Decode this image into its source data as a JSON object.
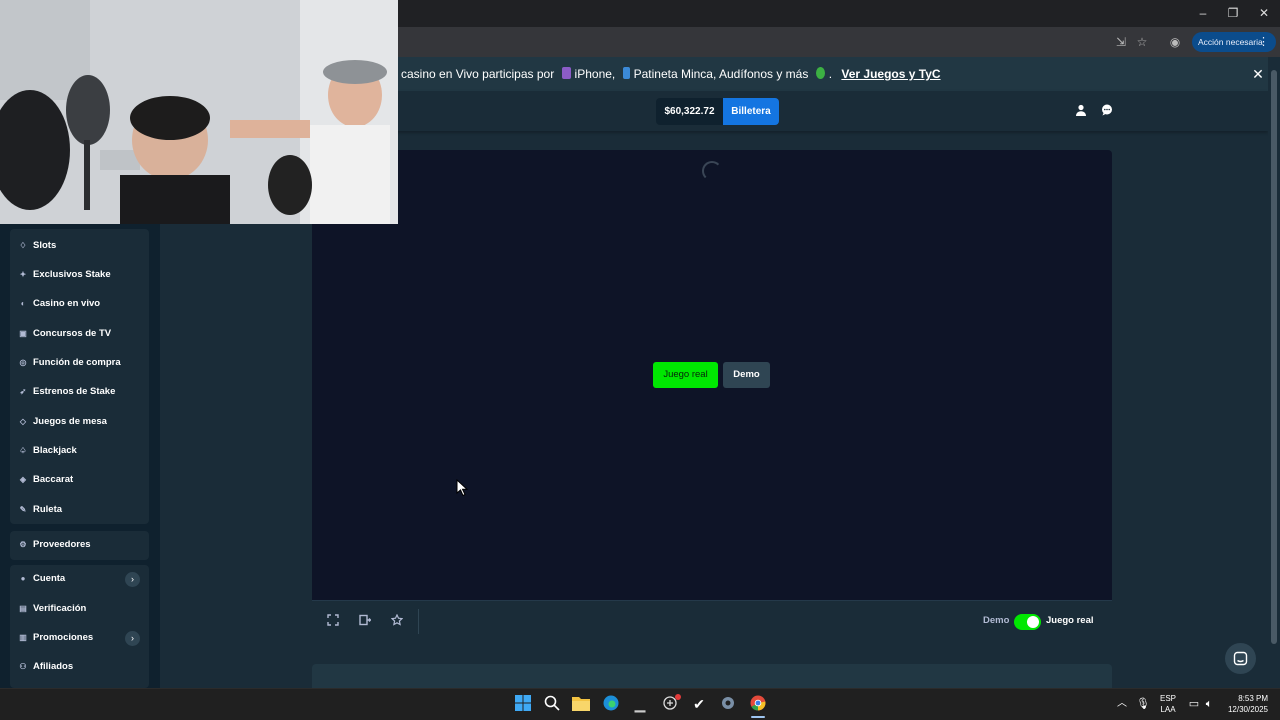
{
  "browser": {
    "window_controls": {
      "minimize": "–",
      "restore": "❐",
      "close": "✕"
    },
    "action_button_label": "Acción necesaria"
  },
  "banner": {
    "text_prefix": "casino en Vivo participas por",
    "item_1": "iPhone,",
    "item_2": "Patineta Minca, Audífonos y más",
    "suffix": ".",
    "link": "Ver Juegos y TyC",
    "close": "✕"
  },
  "header": {
    "balance": "$60,322.72",
    "wallet_label": "Billetera"
  },
  "sidebar": {
    "games": [
      {
        "label": "Slots",
        "icon": "slot-icon"
      },
      {
        "label": "Exclusivos Stake",
        "icon": "star-icon"
      },
      {
        "label": "Casino en vivo",
        "icon": "live-icon"
      },
      {
        "label": "Concursos de TV",
        "icon": "tv-icon"
      },
      {
        "label": "Función de compra",
        "icon": "buy-icon"
      },
      {
        "label": "Estrenos de Stake",
        "icon": "rocket-icon"
      },
      {
        "label": "Juegos de mesa",
        "icon": "dice-icon"
      },
      {
        "label": "Blackjack",
        "icon": "cards-icon"
      },
      {
        "label": "Baccarat",
        "icon": "baccarat-icon"
      },
      {
        "label": "Ruleta",
        "icon": "roulette-icon"
      }
    ],
    "providers": "Proveedores",
    "account": [
      {
        "label": "Cuenta",
        "icon": "user-icon",
        "chevron": "›"
      },
      {
        "label": "Verificación",
        "icon": "id-icon"
      },
      {
        "label": "Promociones",
        "icon": "gift-icon",
        "chevron": "›"
      },
      {
        "label": "Afiliados",
        "icon": "affiliate-icon"
      }
    ]
  },
  "game": {
    "real_button": "Juego real",
    "demo_button": "Demo",
    "footer": {
      "toggle_left": "Demo",
      "toggle_right": "Juego real",
      "toggle_on": true
    }
  },
  "taskbar": {
    "lang_1": "ESP",
    "lang_2": "LAA",
    "time": "8:53 PM",
    "date": "12/30/2025"
  },
  "colors": {
    "bg": "#1a2c38",
    "sidebar_bg": "#0f212e",
    "game_bg": "#0e1427",
    "accent_green": "#00e701",
    "accent_blue": "#1475e1"
  }
}
